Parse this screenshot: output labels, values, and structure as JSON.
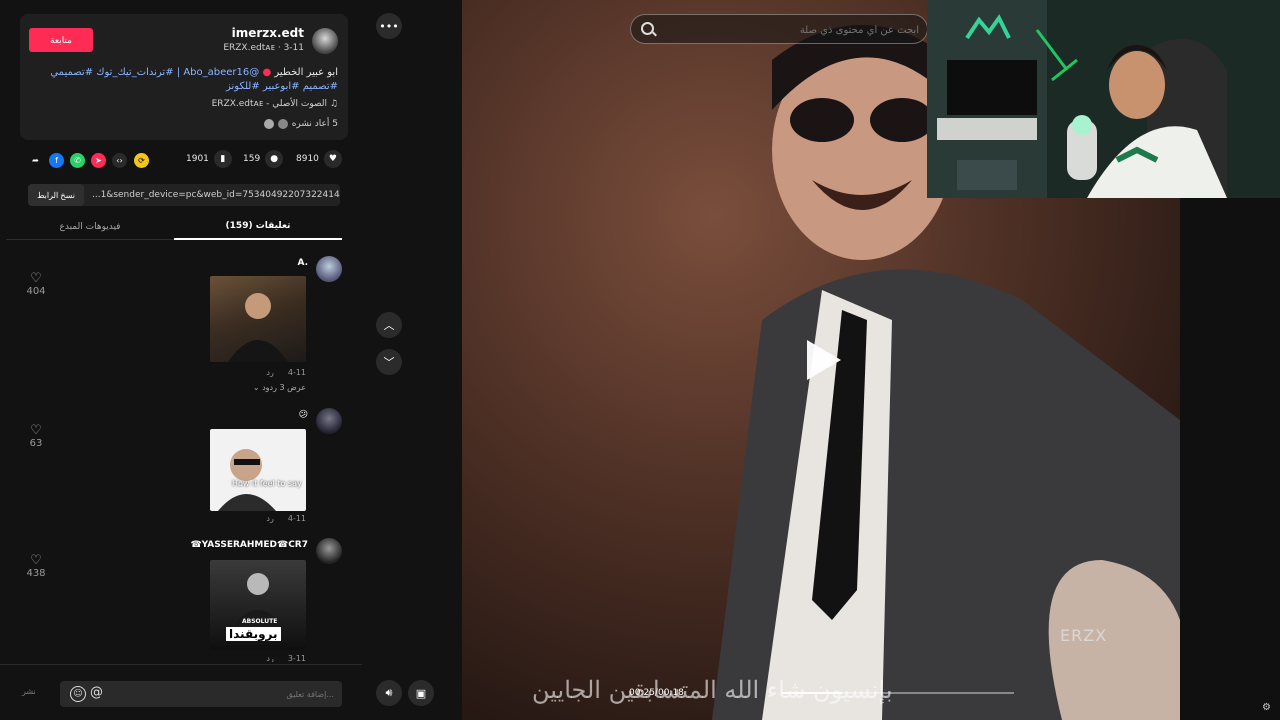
{
  "post": {
    "username": "imerzx.edt",
    "sub": "ERZX.edtᴀᴇ · 3-11",
    "follow_label": "متابعة",
    "description_plain": "ابو عبير الخطير ",
    "description_mention": "@Abo_abeer16 | #ترندات_تيك_توك #تصميمي #تصميم #ابوعبير #للكونز",
    "music": "الصوت الأصلي - ERZX.edtᴀᴇ",
    "reposts": "5 أعاد نشره"
  },
  "actions": {
    "likes": "8910",
    "comments": "159",
    "saves": "1901"
  },
  "share": {
    "icons": [
      "embed-icon",
      "telegram-icon",
      "whatsapp-icon",
      "facebook-icon",
      "forward-icon"
    ],
    "colors": [
      "#2a2a2a",
      "#fe2c55",
      "#25d366",
      "#1877f2",
      "#2a2a2a"
    ]
  },
  "link": {
    "copy_label": "نسخ الرابط",
    "url": "...1&sender_device=pc&web_id=7534049220732241430"
  },
  "tabs": {
    "comments": "تعليقات (159)",
    "creator_videos": "فيديوهات المبدع"
  },
  "comments": [
    {
      "name": "A.",
      "date": "4-11",
      "reply": "رد",
      "likes": "404",
      "more": "عرض 3 ردود"
    },
    {
      "name": "😕",
      "date": "4-11",
      "reply": "رد",
      "likes": "63",
      "overlay": "How it feel to say"
    },
    {
      "name": "☎YASSERAHMED☎CR7",
      "date": "3-11",
      "reply": "رد",
      "likes": "438",
      "overlay_top": "ABSOLUTE",
      "overlay_main": "بروبقندا"
    }
  ],
  "comment_box": {
    "placeholder": "إضافة تعليق...",
    "post_label": "نشر"
  },
  "video": {
    "search_placeholder": "ابحث عن أي محتوى ذي صلة",
    "watermark": "ERZX",
    "caption": "بإنسيون شاء الله المتسابقين الجايين",
    "time": "00:25/00:18",
    "progress": 0.26
  }
}
